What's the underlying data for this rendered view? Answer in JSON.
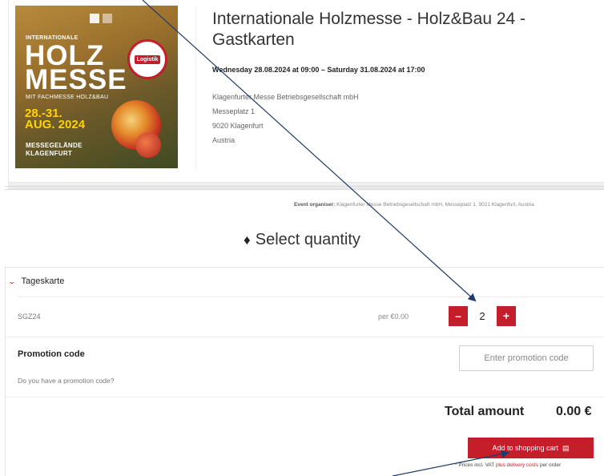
{
  "event": {
    "poster": {
      "top_label": "INTERNATIONALE",
      "line1": "HOLZ",
      "line2": "MESSE",
      "sub": "MIT FACHMESSE HOLZ&BAU",
      "date1": "28.-31.",
      "date2": "AUG. 2024",
      "venue1": "MESSEGELÄNDE",
      "venue2": "KLAGENFURT",
      "seal": "Logistik"
    },
    "title": "Internationale Holzmesse - Holz&Bau 24 - Gastkarten",
    "date_range": "Wednesday 28.08.2024 at 09:00 – Saturday 31.08.2024 at 17:00",
    "address": [
      "Klagenfurter Messe Betriebsgesellschaft mbH",
      "Messeplatz 1",
      "9020 Klagenfurt",
      "Austria"
    ]
  },
  "organiser": {
    "label": "Event organiser:",
    "text": "Klagenfurter Messe Betriebsgesellschaft mbH, Messeplatz 1, 9021 Klagenfurt, Austria"
  },
  "select_quantity": {
    "heading": "Select quantity",
    "icon": "ticket-icon"
  },
  "tickets": {
    "group_name": "Tageskarte",
    "rows": [
      {
        "sku": "SGZ24",
        "price": "per €0.00",
        "quantity": "2",
        "minus": "–",
        "plus": "+"
      }
    ]
  },
  "promotion": {
    "label": "Promotion code",
    "question": "Do you have a promotion code?",
    "placeholder": "Enter promotion code"
  },
  "summary": {
    "total_label": "Total amount",
    "total_value": "0.00 €",
    "cart_button": "Add to shopping cart",
    "cart_icon": "🛒",
    "vat_prefix": "* Prices incl. VAT",
    "vat_link": "plus delivery costs",
    "vat_suffix": "per order"
  },
  "colors": {
    "accent": "#c41e2a",
    "annotation_arrow": "#1f3b6e"
  }
}
